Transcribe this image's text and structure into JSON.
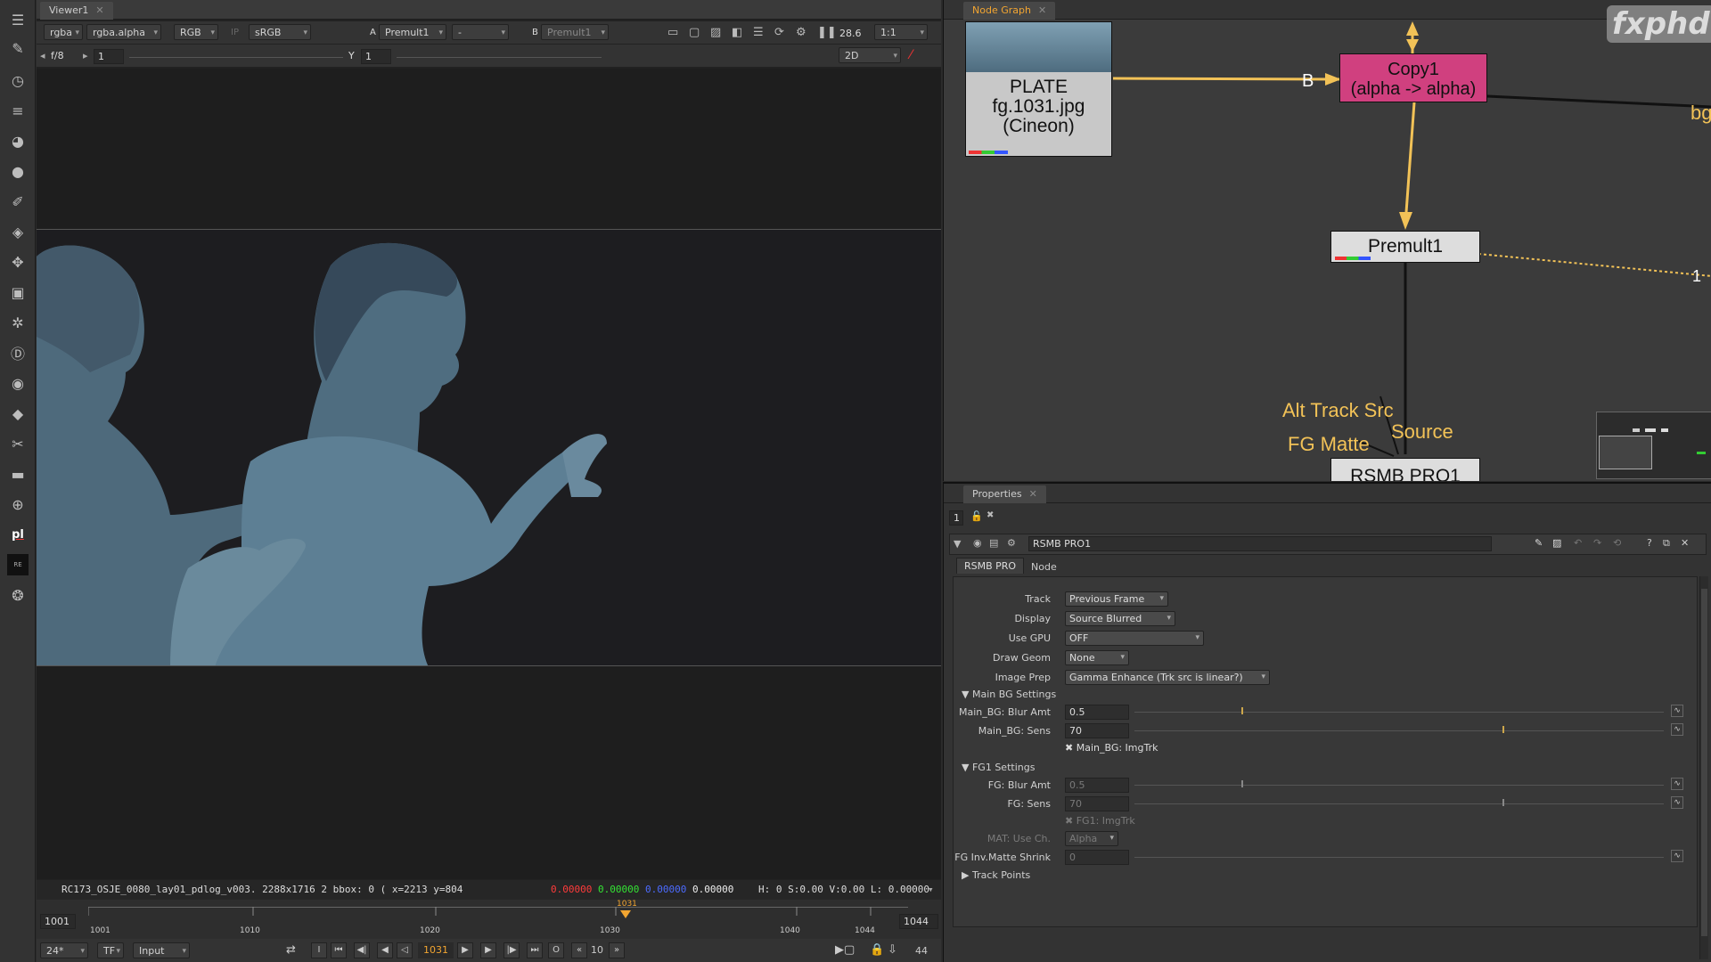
{
  "viewer": {
    "tab_title": "Viewer1",
    "channels": "rgba",
    "alpha": "rgba.alpha",
    "colorspace": "RGB",
    "ip": "IP",
    "lut": "sRGB",
    "input_a_label": "A",
    "input_a": "Premult1",
    "input_a_op": "-",
    "input_b_label": "B",
    "input_b": "Premult1",
    "fps": "28.6",
    "zoom": "1:1",
    "fstop": "f/8",
    "gain": "1",
    "gamma_label": "Y",
    "gamma": "1",
    "view_mode": "2D",
    "info_text": "RC173_OSJE_0080_lay01_pdlog_v003. 2288x1716 2  bbox: 0 (  x=2213 y=804",
    "pix_r": "0.00000",
    "pix_g": "0.00000",
    "pix_b": "0.00000",
    "pix_a": "0.00000",
    "hsv": "H:  0 S:0.00 V:0.00  L: 0.00000"
  },
  "timeline": {
    "start_frame": "1001",
    "end_frame": "1044",
    "current_frame": "1031",
    "ticks": [
      "1001",
      "1010",
      "1020",
      "1030",
      "1040",
      "1044"
    ],
    "fps_setting": "24*",
    "tf": "TF",
    "range_mode": "Input",
    "in_label": "I",
    "out_label": "O",
    "step": "10",
    "end_display": "44"
  },
  "nodegraph": {
    "tab_title": "Node Graph",
    "logo": "fxphd",
    "plate_node": [
      "PLATE",
      "fg.1031.jpg",
      "(Cineon)"
    ],
    "copy_node": [
      "Copy1",
      "(alpha -> alpha)"
    ],
    "premult_node": "Premult1",
    "rsmb_node": "RSMB PRO1",
    "label_b": "B",
    "label_bg": "bg",
    "label_1": "1",
    "label_alt_track": "Alt Track Src",
    "label_source": "Source",
    "label_fg_matte": "FG Matte"
  },
  "properties": {
    "tab_title": "Properties",
    "count": "1",
    "node_name": "RSMB PRO1",
    "tabs": [
      "RSMB PRO",
      "Node"
    ],
    "track_label": "Track",
    "track_value": "Previous Frame",
    "display_label": "Display",
    "display_value": "Source Blurred",
    "gpu_label": "Use GPU",
    "gpu_value": "OFF",
    "geom_label": "Draw Geom",
    "geom_value": "None",
    "prep_label": "Image Prep",
    "prep_value": "Gamma Enhance (Trk src is linear?)",
    "main_bg_section": "Main BG Settings",
    "main_blur_label": "Main_BG: Blur Amt",
    "main_blur_value": "0.5",
    "main_sens_label": "Main_BG: Sens",
    "main_sens_value": "70",
    "main_imgtrk": "Main_BG: ImgTrk",
    "fg1_section": "FG1 Settings",
    "fg_blur_label": "FG: Blur Amt",
    "fg_blur_value": "0.5",
    "fg_sens_label": "FG: Sens",
    "fg_sens_value": "70",
    "fg_imgtrk": "FG1: ImgTrk",
    "mat_label": "MAT: Use Ch.",
    "mat_value": "Alpha",
    "shrink_label": "FG Inv.Matte Shrink",
    "shrink_value": "0",
    "track_points": "Track Points"
  },
  "colors": {
    "accent_orange": "#f2a531",
    "copy_node": "#d0407f",
    "node_wire": "#f2c257",
    "pix_r": "#ff3b3b",
    "pix_g": "#34e334",
    "pix_b": "#4c6bff"
  }
}
